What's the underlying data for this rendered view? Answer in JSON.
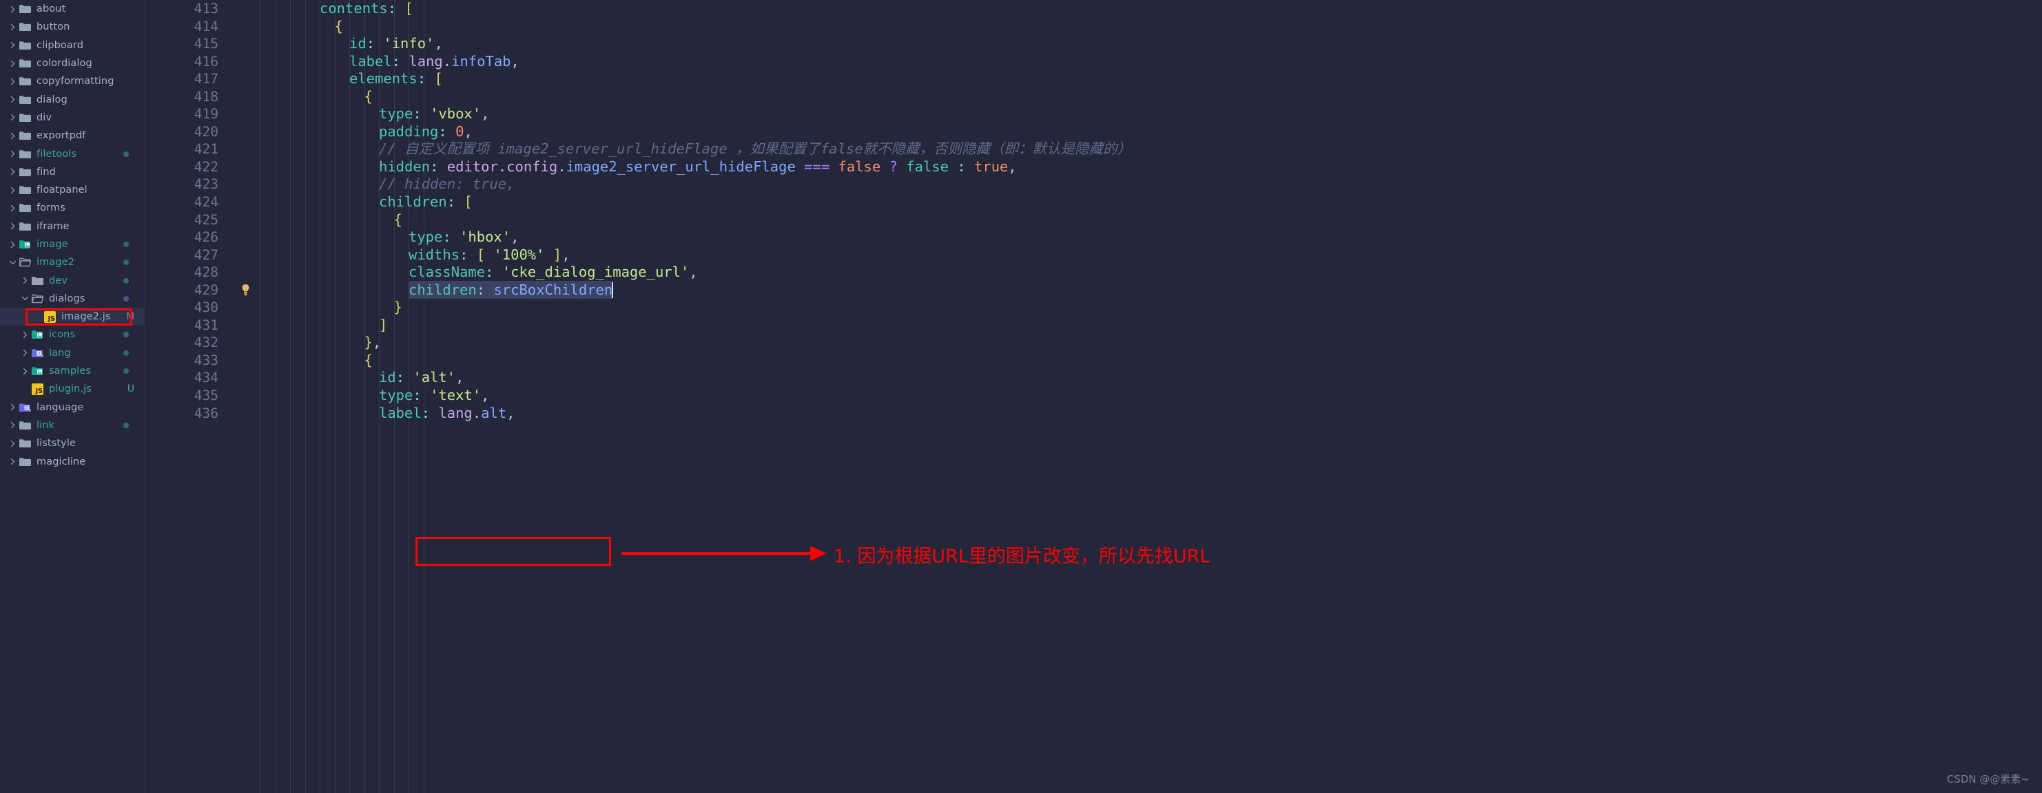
{
  "sidebar": {
    "items": [
      {
        "label": "about",
        "depth": 0,
        "icon": "folder",
        "expanded": false,
        "modified": false,
        "dot": null
      },
      {
        "label": "button",
        "depth": 0,
        "icon": "folder",
        "expanded": false,
        "modified": false,
        "dot": null
      },
      {
        "label": "clipboard",
        "depth": 0,
        "icon": "folder",
        "expanded": false,
        "modified": false,
        "dot": null
      },
      {
        "label": "colordialog",
        "depth": 0,
        "icon": "folder",
        "expanded": false,
        "modified": false,
        "dot": null
      },
      {
        "label": "copyformatting",
        "depth": 0,
        "icon": "folder",
        "expanded": false,
        "modified": false,
        "dot": null
      },
      {
        "label": "dialog",
        "depth": 0,
        "icon": "folder",
        "expanded": false,
        "modified": false,
        "dot": null
      },
      {
        "label": "div",
        "depth": 0,
        "icon": "folder",
        "expanded": false,
        "modified": false,
        "dot": null
      },
      {
        "label": "exportpdf",
        "depth": 0,
        "icon": "folder",
        "expanded": false,
        "modified": false,
        "dot": null
      },
      {
        "label": "filetools",
        "depth": 0,
        "icon": "folder",
        "expanded": false,
        "modified": true,
        "dot": "teal"
      },
      {
        "label": "find",
        "depth": 0,
        "icon": "folder",
        "expanded": false,
        "modified": false,
        "dot": null
      },
      {
        "label": "floatpanel",
        "depth": 0,
        "icon": "folder",
        "expanded": false,
        "modified": false,
        "dot": null
      },
      {
        "label": "forms",
        "depth": 0,
        "icon": "folder",
        "expanded": false,
        "modified": false,
        "dot": null
      },
      {
        "label": "iframe",
        "depth": 0,
        "icon": "folder",
        "expanded": false,
        "modified": false,
        "dot": null
      },
      {
        "label": "image",
        "depth": 0,
        "icon": "folder-image",
        "expanded": false,
        "modified": true,
        "dot": "teal"
      },
      {
        "label": "image2",
        "depth": 0,
        "icon": "folder-open",
        "expanded": true,
        "modified": true,
        "dot": "teal"
      },
      {
        "label": "dev",
        "depth": 1,
        "icon": "folder",
        "expanded": false,
        "modified": true,
        "dot": "teal"
      },
      {
        "label": "dialogs",
        "depth": 1,
        "icon": "folder-open",
        "expanded": true,
        "modified": false,
        "dot": "blue"
      },
      {
        "label": "image2.js",
        "depth": 2,
        "icon": "js",
        "expanded": null,
        "modified": false,
        "dot": null,
        "status": "M",
        "selected": true,
        "boxed": true
      },
      {
        "label": "icons",
        "depth": 1,
        "icon": "folder-image",
        "expanded": false,
        "modified": true,
        "dot": "teal"
      },
      {
        "label": "lang",
        "depth": 1,
        "icon": "folder-lang",
        "expanded": false,
        "modified": true,
        "dot": "teal"
      },
      {
        "label": "samples",
        "depth": 1,
        "icon": "folder-image",
        "expanded": false,
        "modified": true,
        "dot": "teal"
      },
      {
        "label": "plugin.js",
        "depth": 1,
        "icon": "js",
        "expanded": null,
        "modified": true,
        "dot": null,
        "status": "U"
      },
      {
        "label": "language",
        "depth": 0,
        "icon": "folder-lang",
        "expanded": false,
        "modified": false,
        "dot": null
      },
      {
        "label": "link",
        "depth": 0,
        "icon": "folder",
        "expanded": false,
        "modified": true,
        "dot": "teal"
      },
      {
        "label": "liststyle",
        "depth": 0,
        "icon": "folder",
        "expanded": false,
        "modified": false,
        "dot": null
      },
      {
        "label": "magicline",
        "depth": 0,
        "icon": "folder",
        "expanded": false,
        "modified": false,
        "dot": null
      }
    ]
  },
  "editor": {
    "first_line_number": 413,
    "lines": [
      {
        "n": 413,
        "indent": 4,
        "text": "contents: ["
      },
      {
        "n": 414,
        "indent": 5,
        "text": "{"
      },
      {
        "n": 415,
        "indent": 6,
        "text": "id: 'info',"
      },
      {
        "n": 416,
        "indent": 6,
        "text": "label: lang.infoTab,"
      },
      {
        "n": 417,
        "indent": 6,
        "text": "elements: ["
      },
      {
        "n": 418,
        "indent": 7,
        "text": "{"
      },
      {
        "n": 419,
        "indent": 8,
        "text": "type: 'vbox',"
      },
      {
        "n": 420,
        "indent": 8,
        "text": "padding: 0,"
      },
      {
        "n": 421,
        "indent": 8,
        "text": "// 自定义配置项 image2_server_url_hideFlage ，如果配置了false就不隐藏，否则隐藏（即：默认是隐藏的）"
      },
      {
        "n": 422,
        "indent": 8,
        "text": "hidden: editor.config.image2_server_url_hideFlage === false ? false : true,"
      },
      {
        "n": 423,
        "indent": 8,
        "text": "// hidden: true,"
      },
      {
        "n": 424,
        "indent": 8,
        "text": "children: ["
      },
      {
        "n": 425,
        "indent": 9,
        "text": "{"
      },
      {
        "n": 426,
        "indent": 10,
        "text": "type: 'hbox',"
      },
      {
        "n": 427,
        "indent": 10,
        "text": "widths: [ '100%' ],"
      },
      {
        "n": 428,
        "indent": 10,
        "text": "className: 'cke_dialog_image_url',"
      },
      {
        "n": 429,
        "indent": 10,
        "text": "children: srcBoxChildren",
        "highlighted": true,
        "gutter_icon": "lightbulb-icon"
      },
      {
        "n": 430,
        "indent": 9,
        "text": "}"
      },
      {
        "n": 431,
        "indent": 8,
        "text": "]"
      },
      {
        "n": 432,
        "indent": 7,
        "text": "},"
      },
      {
        "n": 433,
        "indent": 7,
        "text": "{"
      },
      {
        "n": 434,
        "indent": 8,
        "text": "id: 'alt',"
      },
      {
        "n": 435,
        "indent": 8,
        "text": "type: 'text',"
      },
      {
        "n": 436,
        "indent": 8,
        "text": "label: lang.alt,"
      }
    ],
    "selection_text": "children: srcBoxChildren",
    "annotation": "1. 因为根据URL里的图片改变，所以先找URL"
  },
  "watermark": "CSDN @@素素~",
  "colors": {
    "background": "#232739",
    "sidebar_bg": "#232739",
    "selection": "#3b4263",
    "annotation_red": "#ff0000",
    "modified_teal": "#3aa6a0",
    "text": "#a8b0cc"
  }
}
